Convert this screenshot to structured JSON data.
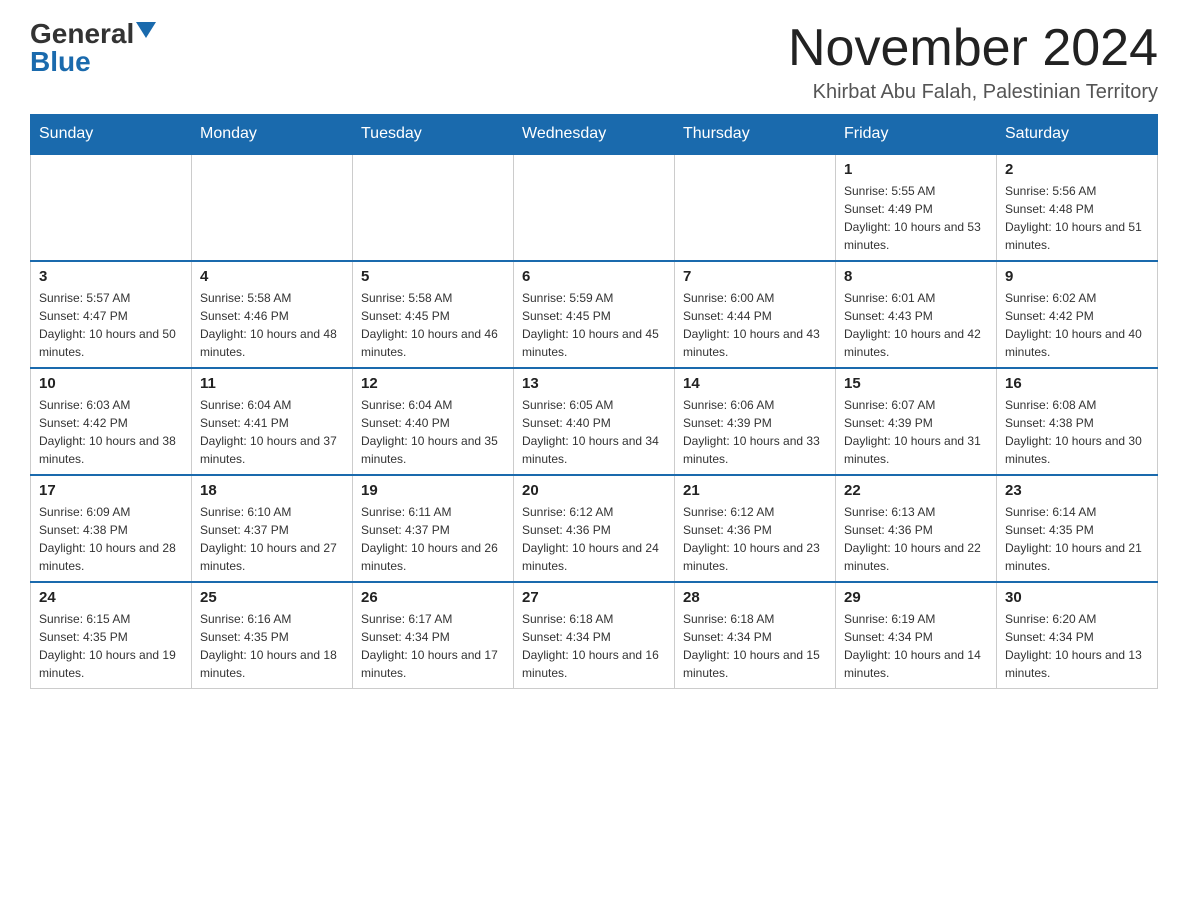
{
  "logo": {
    "general": "General",
    "blue": "Blue"
  },
  "title": "November 2024",
  "location": "Khirbat Abu Falah, Palestinian Territory",
  "days_of_week": [
    "Sunday",
    "Monday",
    "Tuesday",
    "Wednesday",
    "Thursday",
    "Friday",
    "Saturday"
  ],
  "weeks": [
    [
      {
        "day": "",
        "info": ""
      },
      {
        "day": "",
        "info": ""
      },
      {
        "day": "",
        "info": ""
      },
      {
        "day": "",
        "info": ""
      },
      {
        "day": "",
        "info": ""
      },
      {
        "day": "1",
        "info": "Sunrise: 5:55 AM\nSunset: 4:49 PM\nDaylight: 10 hours and 53 minutes."
      },
      {
        "day": "2",
        "info": "Sunrise: 5:56 AM\nSunset: 4:48 PM\nDaylight: 10 hours and 51 minutes."
      }
    ],
    [
      {
        "day": "3",
        "info": "Sunrise: 5:57 AM\nSunset: 4:47 PM\nDaylight: 10 hours and 50 minutes."
      },
      {
        "day": "4",
        "info": "Sunrise: 5:58 AM\nSunset: 4:46 PM\nDaylight: 10 hours and 48 minutes."
      },
      {
        "day": "5",
        "info": "Sunrise: 5:58 AM\nSunset: 4:45 PM\nDaylight: 10 hours and 46 minutes."
      },
      {
        "day": "6",
        "info": "Sunrise: 5:59 AM\nSunset: 4:45 PM\nDaylight: 10 hours and 45 minutes."
      },
      {
        "day": "7",
        "info": "Sunrise: 6:00 AM\nSunset: 4:44 PM\nDaylight: 10 hours and 43 minutes."
      },
      {
        "day": "8",
        "info": "Sunrise: 6:01 AM\nSunset: 4:43 PM\nDaylight: 10 hours and 42 minutes."
      },
      {
        "day": "9",
        "info": "Sunrise: 6:02 AM\nSunset: 4:42 PM\nDaylight: 10 hours and 40 minutes."
      }
    ],
    [
      {
        "day": "10",
        "info": "Sunrise: 6:03 AM\nSunset: 4:42 PM\nDaylight: 10 hours and 38 minutes."
      },
      {
        "day": "11",
        "info": "Sunrise: 6:04 AM\nSunset: 4:41 PM\nDaylight: 10 hours and 37 minutes."
      },
      {
        "day": "12",
        "info": "Sunrise: 6:04 AM\nSunset: 4:40 PM\nDaylight: 10 hours and 35 minutes."
      },
      {
        "day": "13",
        "info": "Sunrise: 6:05 AM\nSunset: 4:40 PM\nDaylight: 10 hours and 34 minutes."
      },
      {
        "day": "14",
        "info": "Sunrise: 6:06 AM\nSunset: 4:39 PM\nDaylight: 10 hours and 33 minutes."
      },
      {
        "day": "15",
        "info": "Sunrise: 6:07 AM\nSunset: 4:39 PM\nDaylight: 10 hours and 31 minutes."
      },
      {
        "day": "16",
        "info": "Sunrise: 6:08 AM\nSunset: 4:38 PM\nDaylight: 10 hours and 30 minutes."
      }
    ],
    [
      {
        "day": "17",
        "info": "Sunrise: 6:09 AM\nSunset: 4:38 PM\nDaylight: 10 hours and 28 minutes."
      },
      {
        "day": "18",
        "info": "Sunrise: 6:10 AM\nSunset: 4:37 PM\nDaylight: 10 hours and 27 minutes."
      },
      {
        "day": "19",
        "info": "Sunrise: 6:11 AM\nSunset: 4:37 PM\nDaylight: 10 hours and 26 minutes."
      },
      {
        "day": "20",
        "info": "Sunrise: 6:12 AM\nSunset: 4:36 PM\nDaylight: 10 hours and 24 minutes."
      },
      {
        "day": "21",
        "info": "Sunrise: 6:12 AM\nSunset: 4:36 PM\nDaylight: 10 hours and 23 minutes."
      },
      {
        "day": "22",
        "info": "Sunrise: 6:13 AM\nSunset: 4:36 PM\nDaylight: 10 hours and 22 minutes."
      },
      {
        "day": "23",
        "info": "Sunrise: 6:14 AM\nSunset: 4:35 PM\nDaylight: 10 hours and 21 minutes."
      }
    ],
    [
      {
        "day": "24",
        "info": "Sunrise: 6:15 AM\nSunset: 4:35 PM\nDaylight: 10 hours and 19 minutes."
      },
      {
        "day": "25",
        "info": "Sunrise: 6:16 AM\nSunset: 4:35 PM\nDaylight: 10 hours and 18 minutes."
      },
      {
        "day": "26",
        "info": "Sunrise: 6:17 AM\nSunset: 4:34 PM\nDaylight: 10 hours and 17 minutes."
      },
      {
        "day": "27",
        "info": "Sunrise: 6:18 AM\nSunset: 4:34 PM\nDaylight: 10 hours and 16 minutes."
      },
      {
        "day": "28",
        "info": "Sunrise: 6:18 AM\nSunset: 4:34 PM\nDaylight: 10 hours and 15 minutes."
      },
      {
        "day": "29",
        "info": "Sunrise: 6:19 AM\nSunset: 4:34 PM\nDaylight: 10 hours and 14 minutes."
      },
      {
        "day": "30",
        "info": "Sunrise: 6:20 AM\nSunset: 4:34 PM\nDaylight: 10 hours and 13 minutes."
      }
    ]
  ]
}
